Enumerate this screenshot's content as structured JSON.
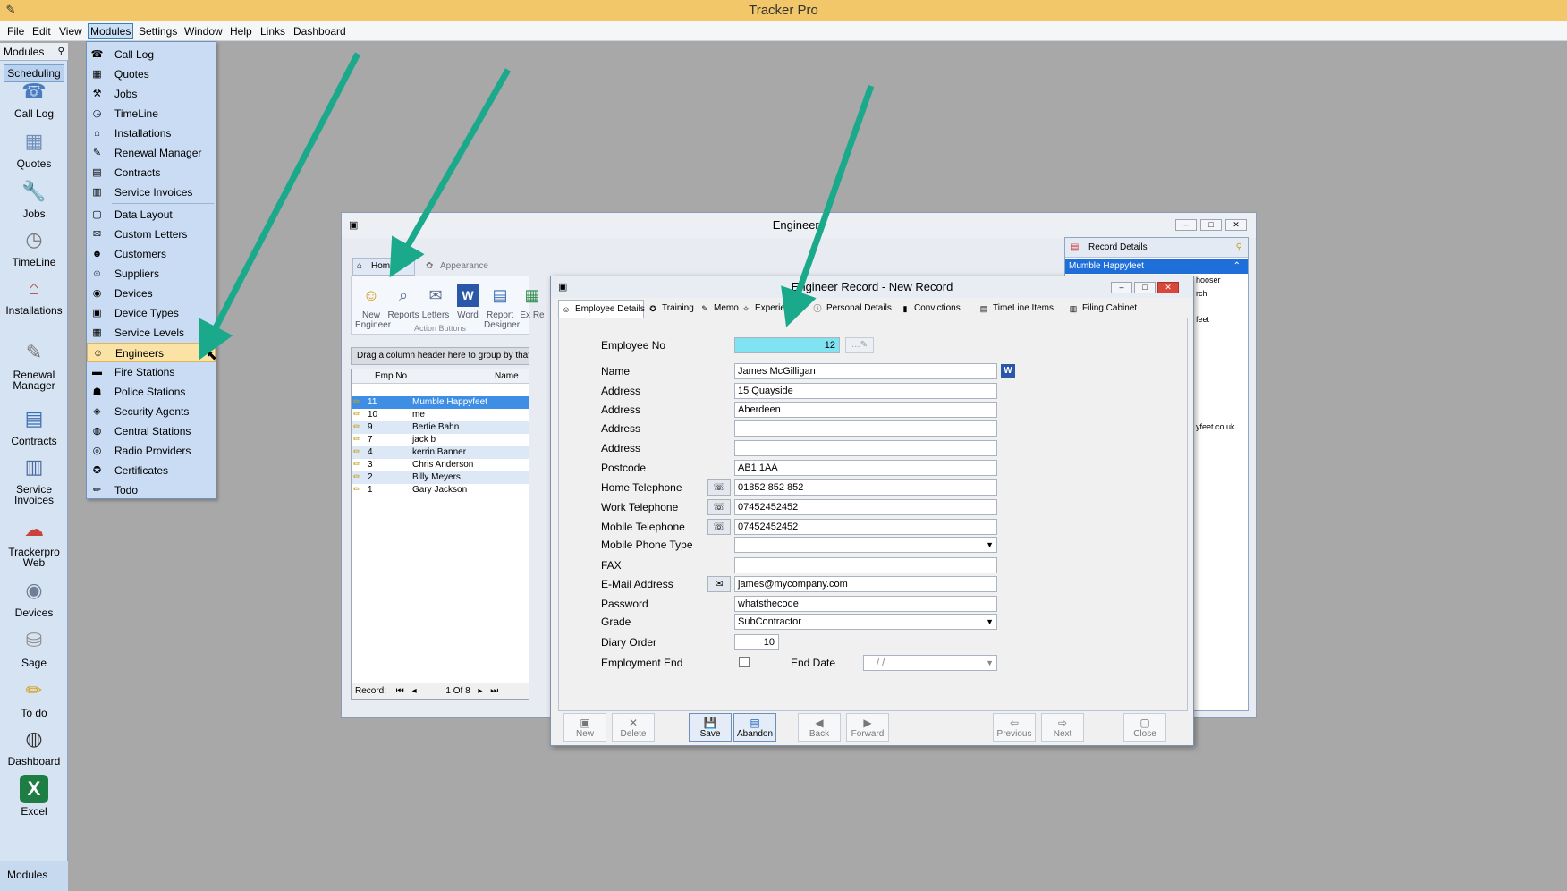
{
  "app": {
    "title": "Tracker Pro"
  },
  "menubar": [
    "File",
    "Edit",
    "View",
    "Modules",
    "Settings",
    "Window",
    "Help",
    "Links",
    "Dashboard"
  ],
  "leftbar": {
    "header": "Modules",
    "group": "Scheduling",
    "items": [
      {
        "label": "Call Log",
        "icon": "call-log-icon",
        "glyph": "☎"
      },
      {
        "label": "Quotes",
        "icon": "calculator-icon",
        "glyph": "▦"
      },
      {
        "label": "Jobs",
        "icon": "wrench-icon",
        "glyph": "🔧"
      },
      {
        "label": "TimeLine",
        "icon": "clock-icon",
        "glyph": "◷"
      },
      {
        "label": "Installations",
        "icon": "house-icon",
        "glyph": "⌂"
      },
      {
        "label": "Renewal Manager",
        "icon": "renewal-icon",
        "glyph": "✎"
      },
      {
        "label": "Contracts",
        "icon": "contract-icon",
        "glyph": "▤"
      },
      {
        "label": "Service Invoices",
        "icon": "invoice-icon",
        "glyph": "▥"
      },
      {
        "label": "Trackerpro Web",
        "icon": "cloud-icon",
        "glyph": "☁"
      },
      {
        "label": "Devices",
        "icon": "devices-icon",
        "glyph": "◉"
      },
      {
        "label": "Sage",
        "icon": "database-icon",
        "glyph": "⛁"
      },
      {
        "label": "To do",
        "icon": "pencil-icon",
        "glyph": "✏"
      },
      {
        "label": "Dashboard",
        "icon": "gauge-icon",
        "glyph": "◍"
      },
      {
        "label": "Excel",
        "icon": "excel-icon",
        "glyph": "X"
      }
    ],
    "footer": "Modules"
  },
  "modules_menu": {
    "items": [
      {
        "label": "Call Log",
        "icon": "call-log-icon",
        "glyph": "☎"
      },
      {
        "label": "Quotes",
        "icon": "calculator-icon",
        "glyph": "▦"
      },
      {
        "label": "Jobs",
        "icon": "wrench-icon",
        "glyph": "⚒"
      },
      {
        "label": "TimeLine",
        "icon": "clock-icon",
        "glyph": "◷"
      },
      {
        "label": "Installations",
        "icon": "house-icon",
        "glyph": "⌂"
      },
      {
        "label": "Renewal Manager",
        "icon": "renewal-icon",
        "glyph": "✎"
      },
      {
        "label": "Contracts",
        "icon": "contract-icon",
        "glyph": "▤"
      },
      {
        "label": "Service Invoices",
        "icon": "invoice-icon",
        "glyph": "▥"
      },
      {
        "label": "Data Layout",
        "icon": "layout-icon",
        "glyph": "▢"
      },
      {
        "label": "Custom Letters",
        "icon": "letter-icon",
        "glyph": "✉"
      },
      {
        "label": "Customers",
        "icon": "customers-icon",
        "glyph": "☻"
      },
      {
        "label": "Suppliers",
        "icon": "suppliers-icon",
        "glyph": "☺"
      },
      {
        "label": "Devices",
        "icon": "devices-icon",
        "glyph": "◉"
      },
      {
        "label": "Device Types",
        "icon": "device-types-icon",
        "glyph": "▣"
      },
      {
        "label": "Service Levels",
        "icon": "service-levels-icon",
        "glyph": "▦"
      },
      {
        "label": "Engineers",
        "icon": "engineer-icon",
        "glyph": "☺"
      },
      {
        "label": "Fire Stations",
        "icon": "fire-icon",
        "glyph": "▬"
      },
      {
        "label": "Police Stations",
        "icon": "police-icon",
        "glyph": "☗"
      },
      {
        "label": "Security Agents",
        "icon": "security-icon",
        "glyph": "◈"
      },
      {
        "label": "Central Stations",
        "icon": "globe-icon",
        "glyph": "◍"
      },
      {
        "label": "Radio Providers",
        "icon": "radio-icon",
        "glyph": "◎"
      },
      {
        "label": "Certificates",
        "icon": "certificate-icon",
        "glyph": "✪"
      },
      {
        "label": "Todo",
        "icon": "pencil-icon",
        "glyph": "✏"
      }
    ],
    "highlighted": "Engineers"
  },
  "engineers_window": {
    "title": "Engineers",
    "ribbon_tabs": [
      "Home",
      "Appearance"
    ],
    "ribbon_buttons": [
      {
        "label": "New Engineer",
        "icon": "new-engineer-icon",
        "glyph": "☺"
      },
      {
        "label": "Reports",
        "icon": "reports-icon",
        "glyph": "⌕"
      },
      {
        "label": "Letters",
        "icon": "letters-icon",
        "glyph": "✉"
      },
      {
        "label": "Word",
        "icon": "word-icon",
        "glyph": "W"
      },
      {
        "label": "Report Designer",
        "icon": "report-designer-icon",
        "glyph": "▤"
      },
      {
        "label": "Ex Re",
        "icon": "export-icon",
        "glyph": "▦"
      }
    ],
    "ribbon_group": "Action Buttons",
    "group_hint": "Drag a column header here to group by that column.",
    "columns": [
      "Emp No",
      "Name"
    ],
    "rows": [
      {
        "no": "11",
        "name": "Mumble Happyfeet"
      },
      {
        "no": "10",
        "name": "me"
      },
      {
        "no": "9",
        "name": "Bertie Bahn"
      },
      {
        "no": "7",
        "name": "jack b"
      },
      {
        "no": "4",
        "name": "kerrin Banner"
      },
      {
        "no": "3",
        "name": "Chris Anderson"
      },
      {
        "no": "2",
        "name": "Billy Meyers"
      },
      {
        "no": "1",
        "name": "Gary Jackson"
      }
    ],
    "navigator": {
      "label": "Record:",
      "position": "1 Of 8"
    },
    "record_details": {
      "title": "Record Details",
      "selected": "Mumble Happyfeet",
      "fragments": [
        "hooser",
        "rch",
        "feet",
        "yfeet.co.uk"
      ]
    }
  },
  "record_window": {
    "title": "Engineer Record - New Record",
    "tabs": [
      {
        "label": "Employee Details",
        "icon": "employee-icon",
        "glyph": "☺"
      },
      {
        "label": "Training",
        "icon": "training-icon",
        "glyph": "✪"
      },
      {
        "label": "Memo",
        "icon": "memo-icon",
        "glyph": "✎"
      },
      {
        "label": "Experience",
        "icon": "experience-icon",
        "glyph": "✧"
      },
      {
        "label": "Personal Details",
        "icon": "info-icon",
        "glyph": "ⓘ"
      },
      {
        "label": "Convictions",
        "icon": "convictions-icon",
        "glyph": "▮"
      },
      {
        "label": "TimeLine Items",
        "icon": "timeline-icon",
        "glyph": "▤"
      },
      {
        "label": "Filing Cabinet",
        "icon": "filing-icon",
        "glyph": "▥"
      }
    ],
    "fields": {
      "employee_no": {
        "label": "Employee No",
        "value": "12"
      },
      "name": {
        "label": "Name",
        "value": "James McGilligan"
      },
      "address1": {
        "label": "Address",
        "value": "15 Quayside"
      },
      "address2": {
        "label": "Address",
        "value": "Aberdeen"
      },
      "address3": {
        "label": "Address",
        "value": ""
      },
      "address4": {
        "label": "Address",
        "value": ""
      },
      "postcode": {
        "label": "Postcode",
        "value": "AB1 1AA"
      },
      "home_tel": {
        "label": "Home Telephone",
        "value": "01852 852 852"
      },
      "work_tel": {
        "label": "Work Telephone",
        "value": "07452452452"
      },
      "mobile_tel": {
        "label": "Mobile Telephone",
        "value": "07452452452"
      },
      "mobile_type": {
        "label": "Mobile Phone Type",
        "value": ""
      },
      "fax": {
        "label": "FAX",
        "value": ""
      },
      "email": {
        "label": "E-Mail Address",
        "value": "james@mycompany.com"
      },
      "password": {
        "label": "Password",
        "value": "whatsthecode"
      },
      "grade": {
        "label": "Grade",
        "value": "SubContractor"
      },
      "diary_order": {
        "label": "Diary Order",
        "value": "10"
      },
      "employment_end": {
        "label": "Employment End"
      },
      "end_date": {
        "label": "End Date",
        "value": "/    /"
      }
    },
    "footer_buttons": [
      "New",
      "Delete",
      "Save",
      "Abandon",
      "Back",
      "Forward",
      "Previous",
      "Next",
      "Close"
    ]
  },
  "colors": {
    "title_bar": "#f2c76a",
    "highlight": "#fbe3a6",
    "arrow": "#1aa98a",
    "employee_no_bg": "#7fe3f2",
    "selection": "#3f8ee5"
  }
}
